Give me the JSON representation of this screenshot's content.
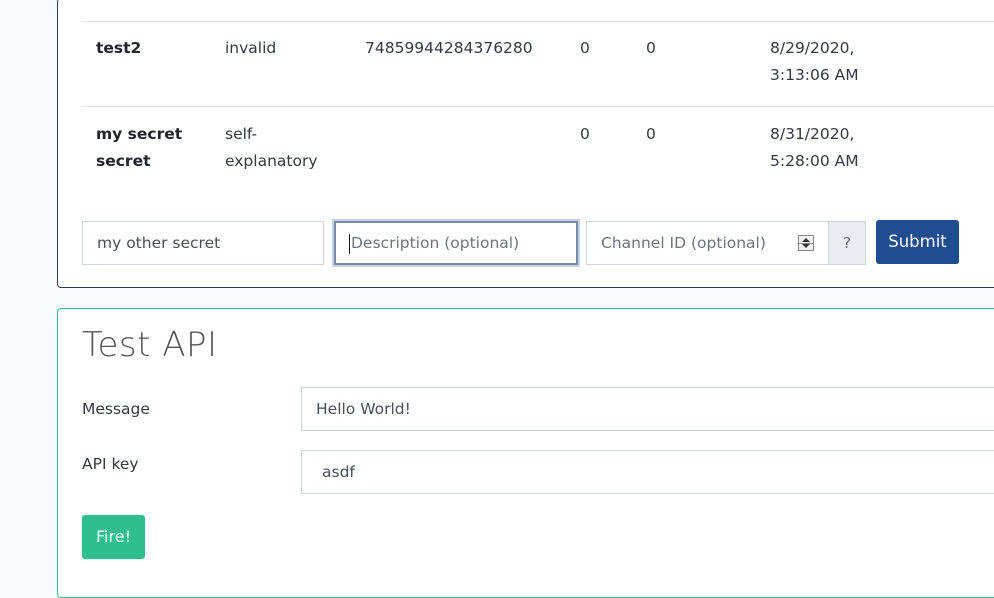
{
  "secrets": {
    "rows": [
      {
        "name": "test2",
        "description": "invalid",
        "channel": "74859944284376280",
        "col_a": "0",
        "col_b": "0",
        "date": "8/29/2020,",
        "time": "3:13:06 AM"
      },
      {
        "name_line1": "my secret",
        "name_line2": "secret",
        "description_line1": "self-",
        "description_line2": "explanatory",
        "channel": "",
        "col_a": "0",
        "col_b": "0",
        "date": "8/31/2020,",
        "time": "5:28:00 AM"
      }
    ],
    "form": {
      "name_value": "my other secret",
      "description_placeholder": "Description (optional)",
      "channel_placeholder": "Channel ID (optional)",
      "help_label": "?",
      "submit_label": "Submit"
    }
  },
  "test_api": {
    "title": "Test API",
    "message_label": "Message",
    "message_value": "Hello World!",
    "api_key_label": "API key",
    "api_key_value": "asdf",
    "fire_label": "Fire!"
  },
  "colors": {
    "primary": "#1f4d8f",
    "success": "#2fbf8f",
    "border_dark": "#2c3e50"
  }
}
